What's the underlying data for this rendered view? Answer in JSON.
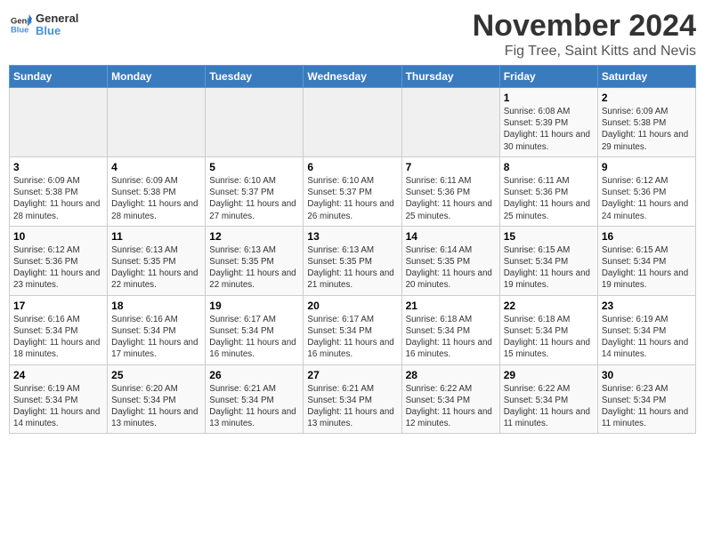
{
  "header": {
    "logo_line1": "General",
    "logo_line2": "Blue",
    "month": "November 2024",
    "location": "Fig Tree, Saint Kitts and Nevis"
  },
  "weekdays": [
    "Sunday",
    "Monday",
    "Tuesday",
    "Wednesday",
    "Thursday",
    "Friday",
    "Saturday"
  ],
  "weeks": [
    [
      {
        "day": "",
        "info": ""
      },
      {
        "day": "",
        "info": ""
      },
      {
        "day": "",
        "info": ""
      },
      {
        "day": "",
        "info": ""
      },
      {
        "day": "",
        "info": ""
      },
      {
        "day": "1",
        "info": "Sunrise: 6:08 AM\nSunset: 5:39 PM\nDaylight: 11 hours and 30 minutes."
      },
      {
        "day": "2",
        "info": "Sunrise: 6:09 AM\nSunset: 5:38 PM\nDaylight: 11 hours and 29 minutes."
      }
    ],
    [
      {
        "day": "3",
        "info": "Sunrise: 6:09 AM\nSunset: 5:38 PM\nDaylight: 11 hours and 28 minutes."
      },
      {
        "day": "4",
        "info": "Sunrise: 6:09 AM\nSunset: 5:38 PM\nDaylight: 11 hours and 28 minutes."
      },
      {
        "day": "5",
        "info": "Sunrise: 6:10 AM\nSunset: 5:37 PM\nDaylight: 11 hours and 27 minutes."
      },
      {
        "day": "6",
        "info": "Sunrise: 6:10 AM\nSunset: 5:37 PM\nDaylight: 11 hours and 26 minutes."
      },
      {
        "day": "7",
        "info": "Sunrise: 6:11 AM\nSunset: 5:36 PM\nDaylight: 11 hours and 25 minutes."
      },
      {
        "day": "8",
        "info": "Sunrise: 6:11 AM\nSunset: 5:36 PM\nDaylight: 11 hours and 25 minutes."
      },
      {
        "day": "9",
        "info": "Sunrise: 6:12 AM\nSunset: 5:36 PM\nDaylight: 11 hours and 24 minutes."
      }
    ],
    [
      {
        "day": "10",
        "info": "Sunrise: 6:12 AM\nSunset: 5:36 PM\nDaylight: 11 hours and 23 minutes."
      },
      {
        "day": "11",
        "info": "Sunrise: 6:13 AM\nSunset: 5:35 PM\nDaylight: 11 hours and 22 minutes."
      },
      {
        "day": "12",
        "info": "Sunrise: 6:13 AM\nSunset: 5:35 PM\nDaylight: 11 hours and 22 minutes."
      },
      {
        "day": "13",
        "info": "Sunrise: 6:13 AM\nSunset: 5:35 PM\nDaylight: 11 hours and 21 minutes."
      },
      {
        "day": "14",
        "info": "Sunrise: 6:14 AM\nSunset: 5:35 PM\nDaylight: 11 hours and 20 minutes."
      },
      {
        "day": "15",
        "info": "Sunrise: 6:15 AM\nSunset: 5:34 PM\nDaylight: 11 hours and 19 minutes."
      },
      {
        "day": "16",
        "info": "Sunrise: 6:15 AM\nSunset: 5:34 PM\nDaylight: 11 hours and 19 minutes."
      }
    ],
    [
      {
        "day": "17",
        "info": "Sunrise: 6:16 AM\nSunset: 5:34 PM\nDaylight: 11 hours and 18 minutes."
      },
      {
        "day": "18",
        "info": "Sunrise: 6:16 AM\nSunset: 5:34 PM\nDaylight: 11 hours and 17 minutes."
      },
      {
        "day": "19",
        "info": "Sunrise: 6:17 AM\nSunset: 5:34 PM\nDaylight: 11 hours and 16 minutes."
      },
      {
        "day": "20",
        "info": "Sunrise: 6:17 AM\nSunset: 5:34 PM\nDaylight: 11 hours and 16 minutes."
      },
      {
        "day": "21",
        "info": "Sunrise: 6:18 AM\nSunset: 5:34 PM\nDaylight: 11 hours and 16 minutes."
      },
      {
        "day": "22",
        "info": "Sunrise: 6:18 AM\nSunset: 5:34 PM\nDaylight: 11 hours and 15 minutes."
      },
      {
        "day": "23",
        "info": "Sunrise: 6:19 AM\nSunset: 5:34 PM\nDaylight: 11 hours and 14 minutes."
      }
    ],
    [
      {
        "day": "24",
        "info": "Sunrise: 6:19 AM\nSunset: 5:34 PM\nDaylight: 11 hours and 14 minutes."
      },
      {
        "day": "25",
        "info": "Sunrise: 6:20 AM\nSunset: 5:34 PM\nDaylight: 11 hours and 13 minutes."
      },
      {
        "day": "26",
        "info": "Sunrise: 6:21 AM\nSunset: 5:34 PM\nDaylight: 11 hours and 13 minutes."
      },
      {
        "day": "27",
        "info": "Sunrise: 6:21 AM\nSunset: 5:34 PM\nDaylight: 11 hours and 13 minutes."
      },
      {
        "day": "28",
        "info": "Sunrise: 6:22 AM\nSunset: 5:34 PM\nDaylight: 11 hours and 12 minutes."
      },
      {
        "day": "29",
        "info": "Sunrise: 6:22 AM\nSunset: 5:34 PM\nDaylight: 11 hours and 11 minutes."
      },
      {
        "day": "30",
        "info": "Sunrise: 6:23 AM\nSunset: 5:34 PM\nDaylight: 11 hours and 11 minutes."
      }
    ]
  ]
}
